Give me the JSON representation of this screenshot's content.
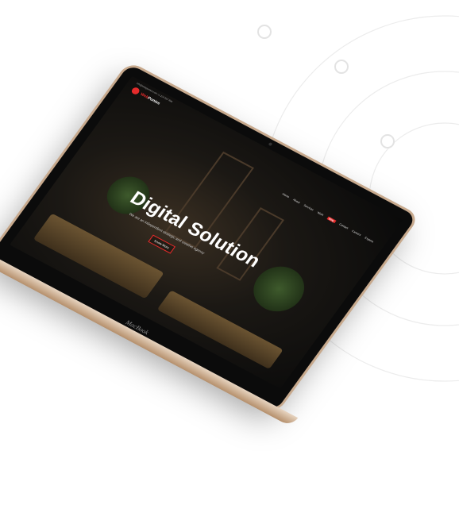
{
  "screen": {
    "brand_logo_text": "Web",
    "brand_logo_accent": "Ponies",
    "topbar_text": "info@webponies.com   +1 234 567 890",
    "nav_items": [
      "Home",
      "About",
      "Services",
      "Work",
      "Blog",
      "Contact",
      "Careers",
      "Explore"
    ],
    "active_nav_index": 4,
    "hero_title": "Digital Solution",
    "hero_subtitle": "We are an independent strategic and creative agency",
    "hero_button": "Know More"
  },
  "device_brand": "MacBook",
  "colors": {
    "accent": "#e52b2b",
    "lid": "#c7a98d",
    "bezel": "#0b0b0b"
  }
}
